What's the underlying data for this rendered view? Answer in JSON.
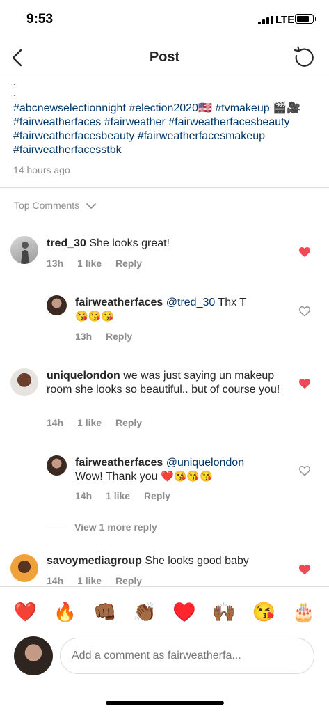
{
  "status_bar": {
    "time": "9:53",
    "network": "LTE"
  },
  "nav": {
    "title": "Post"
  },
  "caption": {
    "dots": [
      ".",
      "."
    ],
    "hashtags": "#abcnewselectionnight #election2020🇺🇸 #tvmakeup 🎬🎥 #fairweatherfaces #fairweather #fairweatherfacesbeauty #fairweatherfacesbeauty #fairweatherfacesmakeup #fairweatherfacesstbk",
    "timestamp": "14 hours ago"
  },
  "top_comments_label": "Top Comments",
  "comments": [
    {
      "username": "tred_30",
      "text": "She looks great!",
      "time": "13h",
      "likes": "1 like",
      "reply": "Reply",
      "liked": true
    },
    {
      "username": "fairweatherfaces",
      "mention": "@tred_30",
      "text": "Thx T",
      "emojis": "😘😘😘",
      "time": "13h",
      "reply": "Reply",
      "liked": false
    },
    {
      "username": "uniquelondon",
      "text": "we was just saying un makeup  room she looks  so beautiful.. but of course you!",
      "time": "14h",
      "likes": "1 like",
      "reply": "Reply",
      "liked": true
    },
    {
      "username": "fairweatherfaces",
      "mention": "@uniquelondon",
      "text": "Wow! Thank you",
      "emojis": "❤️😘😘😘",
      "time": "14h",
      "likes": "1 like",
      "reply": "Reply",
      "liked": false
    },
    {
      "username": "savoymediagroup",
      "text": "She looks good baby",
      "time": "14h",
      "likes": "1 like",
      "reply": "Reply",
      "liked": true
    }
  ],
  "view_more_label": "View 1 more reply",
  "emoji_bar": [
    "❤️",
    "🔥",
    "👊🏾",
    "👏🏾",
    "♥️",
    "🙌🏾",
    "😘",
    "🎂"
  ],
  "composer": {
    "placeholder": "Add a comment as fairweatherfa..."
  },
  "colors": {
    "heart_liked": "#ed4956",
    "link": "#00376b",
    "muted": "#8e8e8e"
  }
}
